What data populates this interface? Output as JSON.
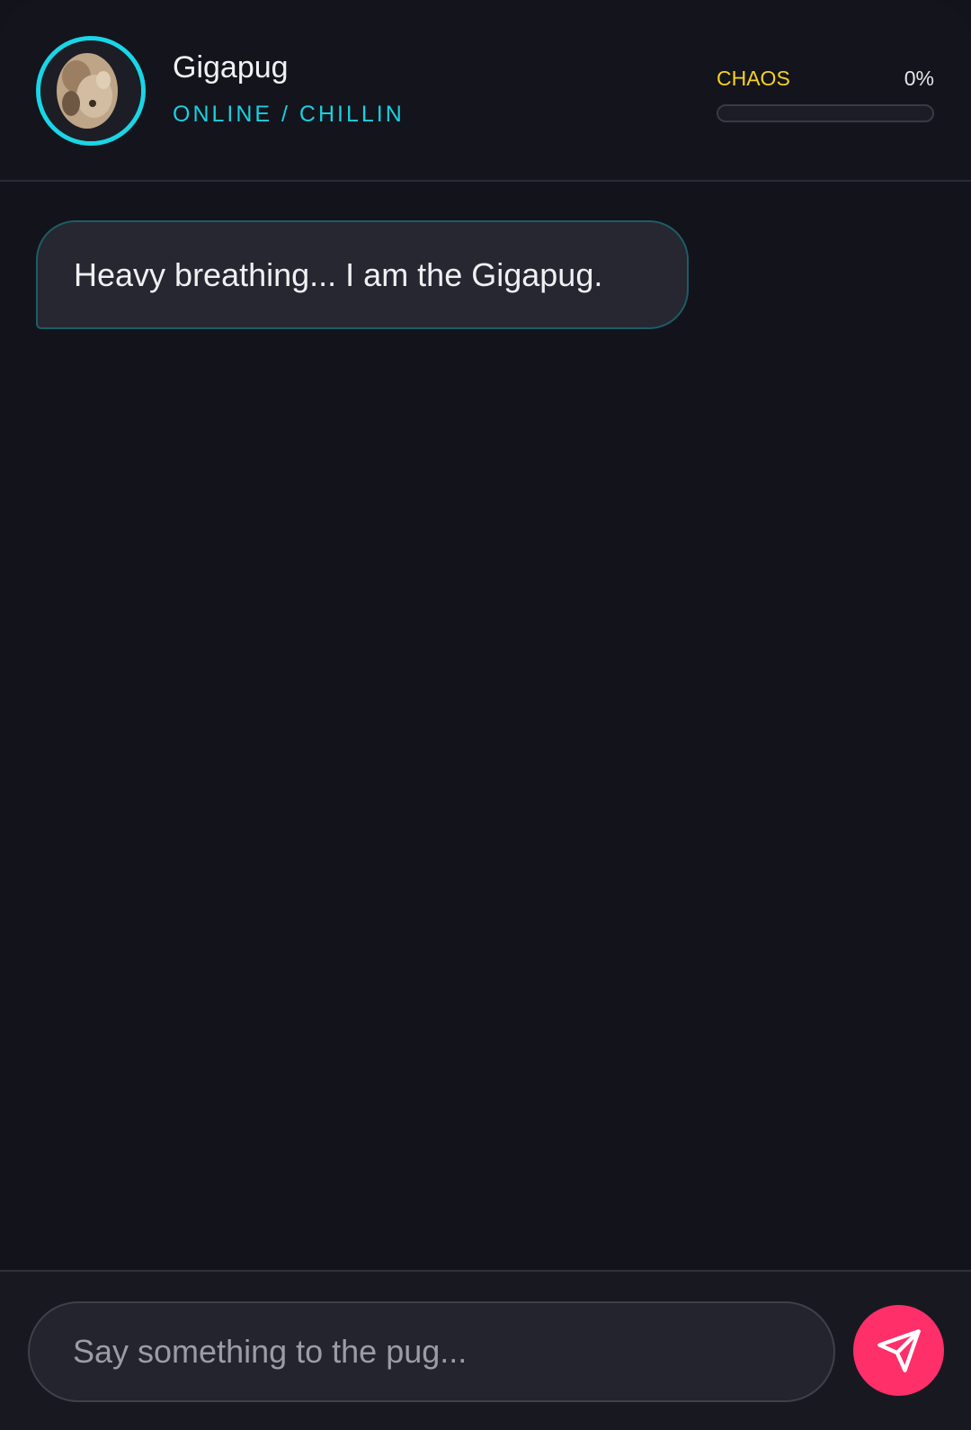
{
  "header": {
    "name": "Gigapug",
    "status": "ONLINE / CHILLIN",
    "avatar_icon": "pug-avatar-icon",
    "chaos": {
      "label": "CHAOS",
      "value_text": "0%",
      "value": 0,
      "color": "#f5d320"
    }
  },
  "messages": [
    {
      "sender": "Gigapug",
      "text": "Heavy breathing... I am the Gigapug."
    }
  ],
  "composer": {
    "placeholder": "Say something to the pug...",
    "value": "",
    "send_icon": "send-icon"
  },
  "colors": {
    "accent": "#19d6e6",
    "send": "#ff2f69",
    "chaos": "#f5d320",
    "background": "#13131b"
  }
}
